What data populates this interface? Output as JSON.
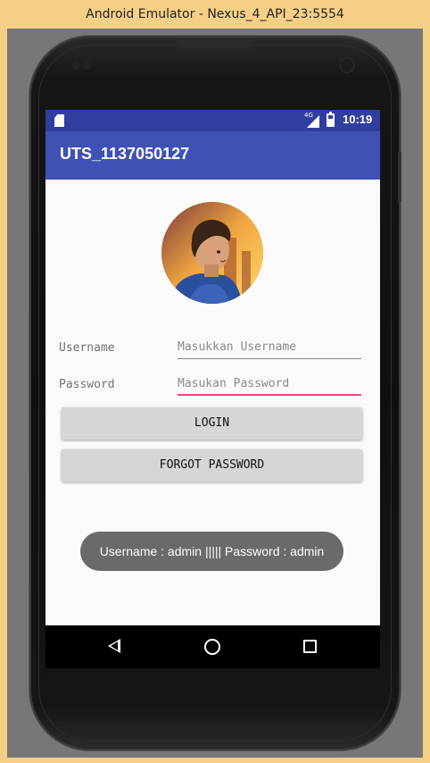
{
  "window": {
    "title": "Android Emulator - Nexus_4_API_23:5554"
  },
  "statusbar": {
    "network": "4G",
    "time": "10:19",
    "icons": [
      "sd-card-icon",
      "signal-icon",
      "battery-icon"
    ]
  },
  "appbar": {
    "title": "UTS_1137050127"
  },
  "form": {
    "username_label": "Username",
    "username_placeholder": "Masukkan Username",
    "username_value": "",
    "password_label": "Password",
    "password_placeholder": "Masukan Password",
    "password_value": "",
    "login_label": "LOGIN",
    "forgot_label": "FORGOT PASSWORD"
  },
  "toast": {
    "text": "Username : admin ||||| Password : admin"
  },
  "navbar": {
    "icons": [
      "back-icon",
      "home-icon",
      "recents-icon"
    ]
  },
  "colors": {
    "status_bar": "#303f9f",
    "app_bar": "#3f51b5",
    "accent": "#ff4081",
    "button": "#d6d6d6",
    "toast": "#6a6a6a",
    "window_chrome": "#f6cf86"
  }
}
